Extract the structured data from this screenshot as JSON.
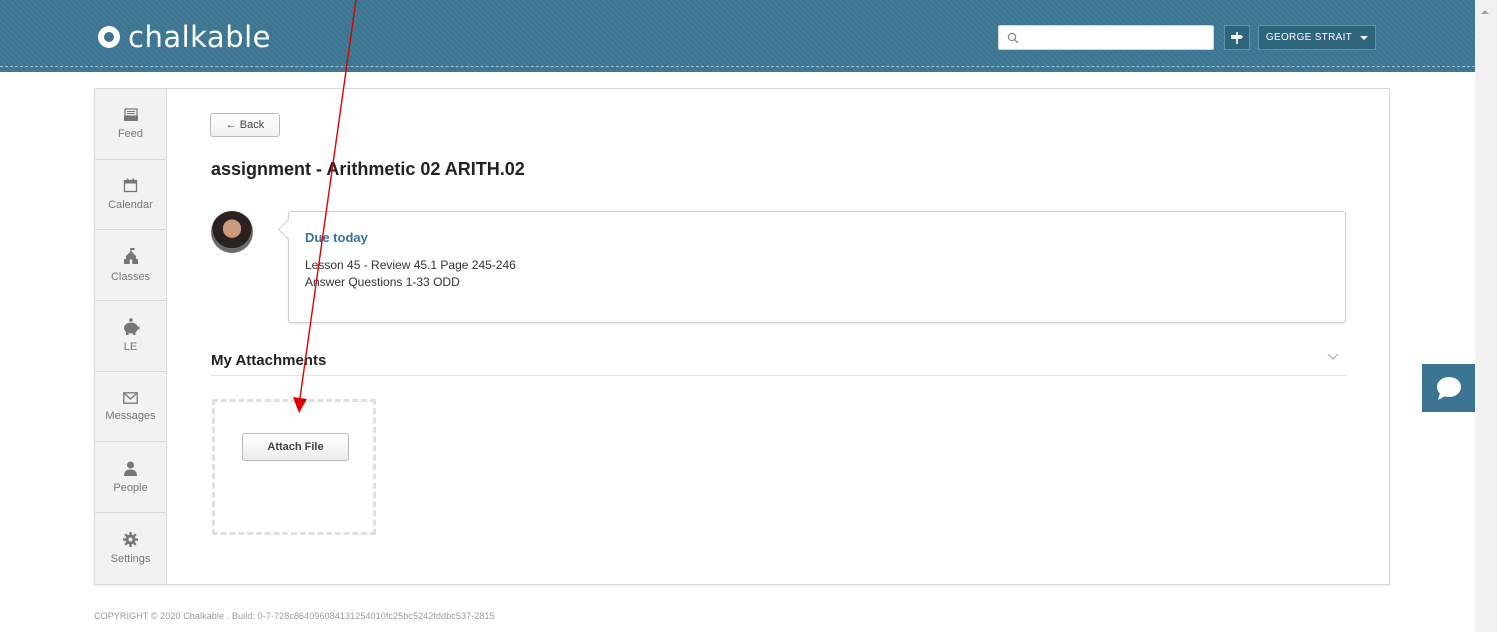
{
  "header": {
    "logo_text": "chalkable",
    "search": {
      "value": "",
      "placeholder": ""
    },
    "user_name": "GEORGE STRAIT"
  },
  "sidebar": {
    "items": [
      {
        "label": "Feed",
        "icon": "inbox-tray-icon"
      },
      {
        "label": "Calendar",
        "icon": "calendar-icon"
      },
      {
        "label": "Classes",
        "icon": "schoolhouse-icon"
      },
      {
        "label": "LE",
        "icon": "piggy-bank-icon"
      },
      {
        "label": "Messages",
        "icon": "envelope-icon"
      },
      {
        "label": "People",
        "icon": "person-icon"
      },
      {
        "label": "Settings",
        "icon": "gear-icon"
      }
    ]
  },
  "main": {
    "back_label": "← Back",
    "title": "assignment - Arithmetic 02 ARITH.02",
    "due_label": "Due today",
    "description": {
      "line1": "Lesson 45 - Review 45.1 Page 245-246",
      "line2": "Answer Questions 1-33 ODD"
    },
    "attachments_title": "My Attachments",
    "attach_button": "Attach File"
  },
  "footer": {
    "copyright": "COPYRIGHT © 2020 Chalkable . Build: 0-7-728c864096084131254010fc25bc5242fddbc537-2815"
  },
  "colors": {
    "brand": "#3b7591",
    "due_text": "#3a7497",
    "annotation_arrow": "#e00000"
  }
}
